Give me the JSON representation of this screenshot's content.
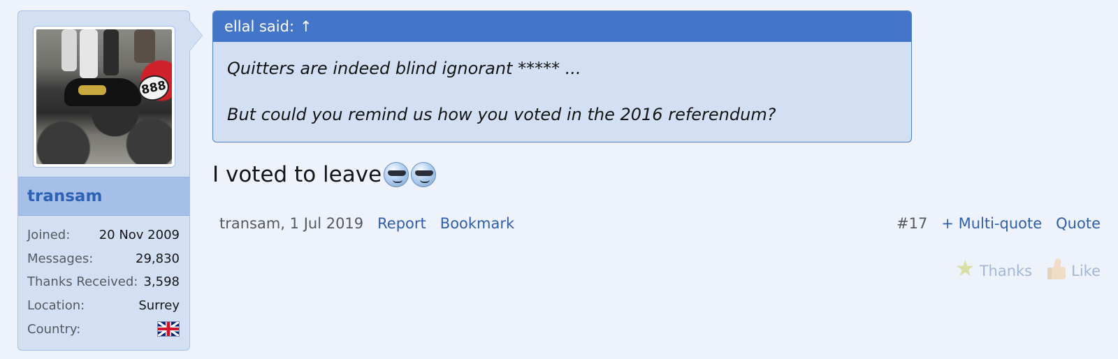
{
  "user": {
    "username": "transam",
    "stats": [
      {
        "label": "Joined:",
        "value": "20 Nov 2009"
      },
      {
        "label": "Messages:",
        "value": "29,830"
      },
      {
        "label": "Thanks Received:",
        "value": "3,598"
      },
      {
        "label": "Location:",
        "value": "Surrey"
      },
      {
        "label": "Country:",
        "value": ""
      }
    ],
    "country_flag": "uk-flag-icon",
    "avatar_plate": "888"
  },
  "quote": {
    "attribution": "ellal said:",
    "jump_arrow": "↑",
    "lines": [
      "Quitters are indeed blind ignorant ***** ...",
      "But could you remind us how you voted in the 2016 referendum?"
    ]
  },
  "message": {
    "text": "I voted to leave",
    "smilies": [
      "cool-smilie-icon",
      "cool-smilie-icon"
    ]
  },
  "meta": {
    "author_date": "transam, 1 Jul 2019",
    "report": "Report",
    "bookmark": "Bookmark",
    "post_number": "#17",
    "multi_quote": "+ Multi-quote",
    "quote": "Quote"
  },
  "reactions": {
    "thanks": "Thanks",
    "like": "Like"
  },
  "colors": {
    "page_bg": "#eef3fb",
    "panel_bg": "#d3e0f4",
    "quote_header": "#4375c9",
    "username": "#2e62b4",
    "link": "#2f5ea8"
  }
}
